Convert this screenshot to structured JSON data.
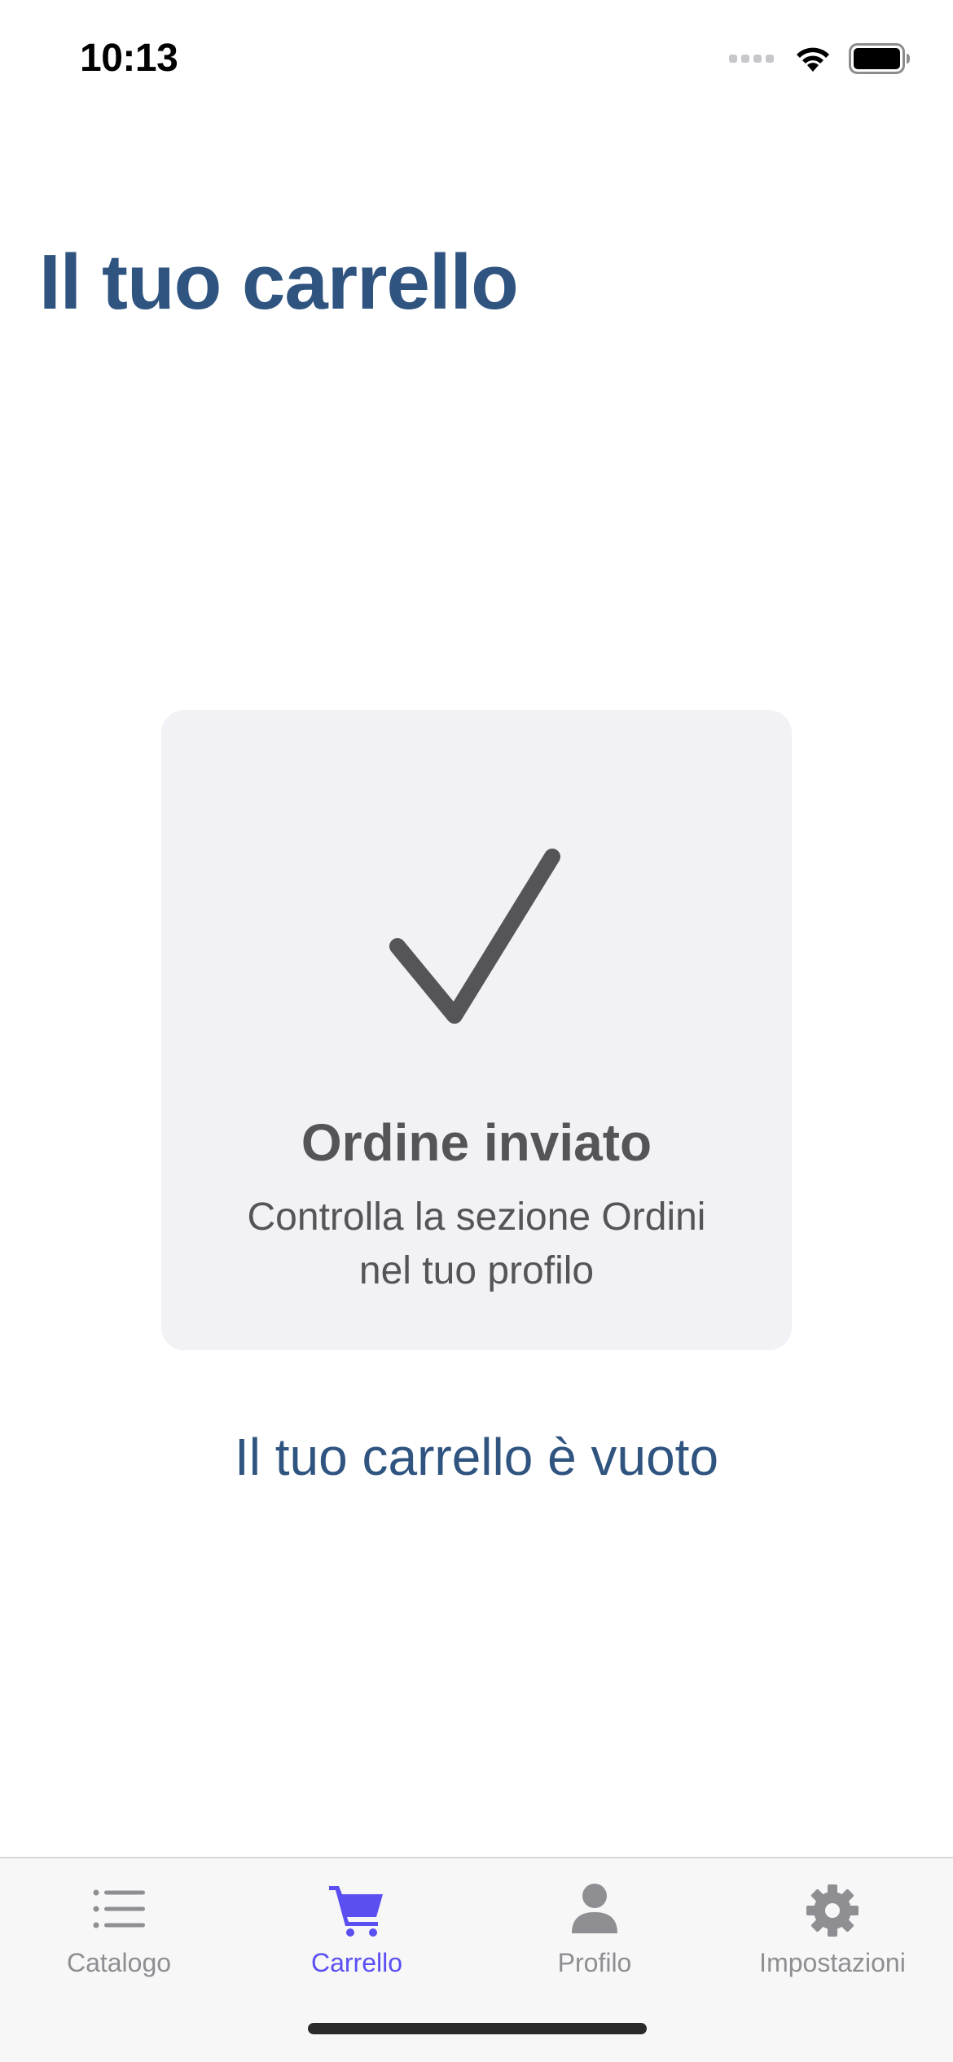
{
  "status_bar": {
    "time": "10:13"
  },
  "page": {
    "title": "Il tuo carrello"
  },
  "confirmation": {
    "icon": "checkmark-icon",
    "title": "Ordine inviato",
    "description": "Controlla la sezione Ordini nel tuo profilo"
  },
  "cart": {
    "empty_message": "Il tuo carrello è vuoto"
  },
  "tab_bar": {
    "active_color": "#5b4ff2",
    "inactive_color": "#8e8e93",
    "tabs": [
      {
        "label": "Catalogo",
        "icon": "list-icon",
        "active": false
      },
      {
        "label": "Carrello",
        "icon": "cart-icon",
        "active": true
      },
      {
        "label": "Profilo",
        "icon": "person-icon",
        "active": false
      },
      {
        "label": "Impostazioni",
        "icon": "gear-icon",
        "active": false
      }
    ]
  },
  "colors": {
    "title": "#2f5480",
    "card_background": "#f1f1f6",
    "card_text": "#555558"
  }
}
